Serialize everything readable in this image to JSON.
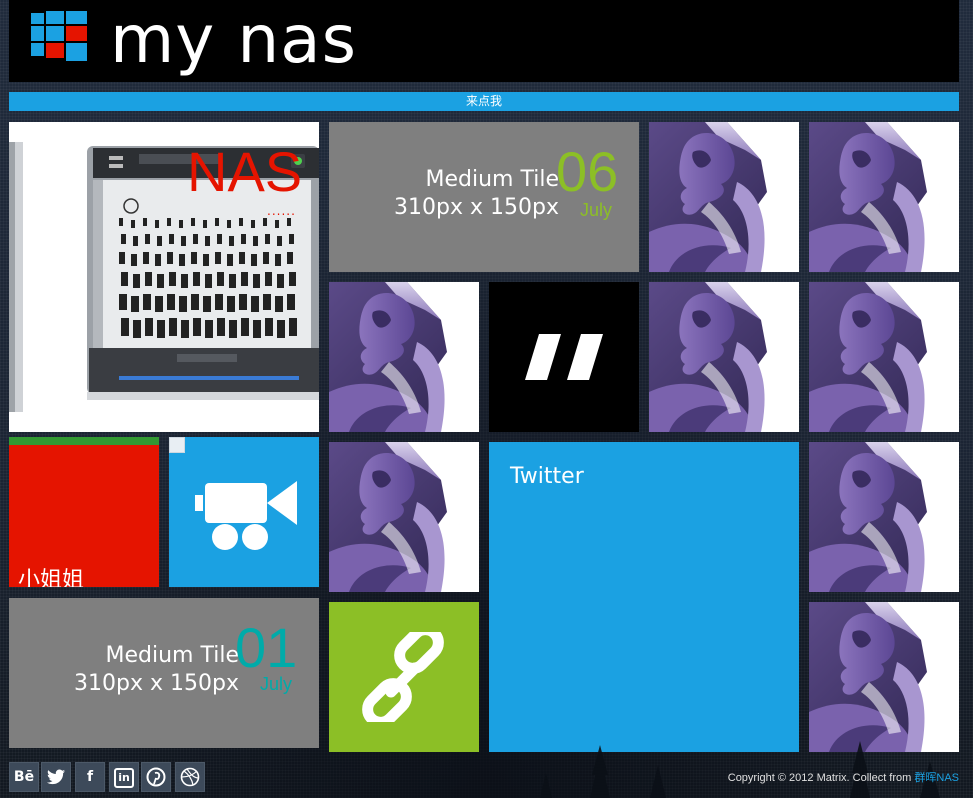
{
  "header": {
    "title": "my nas",
    "logo_icon": "windows-logo-icon"
  },
  "ribbon": {
    "label": "来点我"
  },
  "tiles": {
    "nas": {
      "title": "NAS",
      "dots": "......",
      "image": "hp-microserver-image"
    },
    "medium_1": {
      "line1": "Medium Tile",
      "line2": "310px x 150px",
      "day": "06",
      "month": "July",
      "accent": "#8cbf26"
    },
    "medium_2": {
      "line1": "Medium Tile",
      "line2": "310px x 150px",
      "day": "01",
      "month": "July",
      "accent": "#00aba9"
    },
    "quote": {
      "icon": "quote-icon"
    },
    "red": {
      "label": "小姐姐",
      "color": "#e51400",
      "top_stripe": "#339933"
    },
    "video": {
      "icon": "video-camera-icon",
      "color": "#1ba1e2"
    },
    "twitter": {
      "label": "Twitter",
      "color": "#1ba1e2"
    },
    "link": {
      "icon": "link-icon",
      "color": "#8cbf26"
    },
    "purple_image": "woman-profile-art-image"
  },
  "footer": {
    "social": [
      {
        "label": "Bē",
        "icon": "behance-icon"
      },
      {
        "label": "",
        "icon": "twitter-icon"
      },
      {
        "label": "f",
        "icon": "facebook-icon"
      },
      {
        "label": "in",
        "icon": "linkedin-icon"
      },
      {
        "label": "",
        "icon": "pinterest-icon"
      },
      {
        "label": "",
        "icon": "dribbble-icon"
      }
    ],
    "copyright_text": "Copyright © 2012 Matrix. Collect from ",
    "copyright_link": "群晖NAS"
  }
}
